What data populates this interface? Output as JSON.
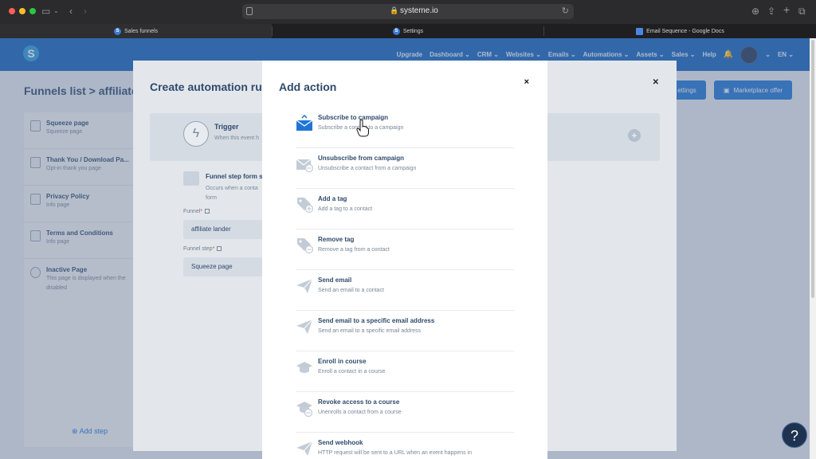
{
  "browser": {
    "url": "systeme.io",
    "tabs": [
      {
        "label": "Sales funnels",
        "icon": "systeme-favicon"
      },
      {
        "label": "Settings",
        "icon": "systeme-favicon"
      },
      {
        "label": "Email Sequence - Google Docs",
        "icon": "google-docs-icon"
      }
    ]
  },
  "navbar": {
    "logo_letter": "S",
    "items": [
      "Upgrade",
      "Dashboard ⌄",
      "CRM ⌄",
      "Websites ⌄",
      "Emails ⌄",
      "Automations ⌄",
      "Assets ⌄",
      "Sales ⌄",
      "Help"
    ],
    "language": "EN ⌄"
  },
  "page": {
    "breadcrumb": "Funnels list  >  affiliate la",
    "settings_button": "ettings",
    "marketplace_button": "Marketplace offer"
  },
  "sidebar": {
    "steps": [
      {
        "title": "Squeeze page",
        "subtitle": "Squeeze page"
      },
      {
        "title": "Thank You / Download Pa...",
        "subtitle": "Opt-in thank you page"
      },
      {
        "title": "Privacy Policy",
        "subtitle": "Info page"
      },
      {
        "title": "Terms and Conditions",
        "subtitle": "Info page"
      },
      {
        "title": "Inactive Page",
        "subtitle": "This page is displayed when the",
        "subtitle2": "disabled"
      }
    ],
    "add_step": "Add step"
  },
  "automation_modal": {
    "title": "Create automation rule",
    "trigger_title": "Trigger",
    "trigger_subtitle": "When this event h",
    "form_step_title": "Funnel step form su",
    "form_step_subtitle": "Occurs when a conta form",
    "funnel_label": "Funnel",
    "funnel_value": "affiliate lander",
    "funnel_step_label": "Funnel step",
    "funnel_step_value": "Squeeze page"
  },
  "add_action_modal": {
    "title": "Add action",
    "close": "×",
    "actions": [
      {
        "title": "Subscribe to campaign",
        "subtitle": "Subscribe a contact to a campaign",
        "icon": "campaign-subscribe-icon"
      },
      {
        "title": "Unsubscribe from campaign",
        "subtitle": "Unsubscribe a contact from a campaign",
        "icon": "campaign-unsubscribe-icon"
      },
      {
        "title": "Add a tag",
        "subtitle": "Add a tag to a contact",
        "icon": "tag-add-icon"
      },
      {
        "title": "Remove tag",
        "subtitle": "Remove a tag from a contact",
        "icon": "tag-remove-icon"
      },
      {
        "title": "Send email",
        "subtitle": "Send an email to a contact",
        "icon": "paper-plane-icon"
      },
      {
        "title": "Send email to a specific email address",
        "subtitle": "Send an email to a specific email address",
        "icon": "paper-plane-icon"
      },
      {
        "title": "Enroll in course",
        "subtitle": "Enroll a contact in a course",
        "icon": "graduation-cap-icon"
      },
      {
        "title": "Revoke access to a course",
        "subtitle": "Unenrolls a contact from a course",
        "icon": "graduation-cap-revoke-icon"
      },
      {
        "title": "Send webhook",
        "subtitle": "HTTP request will be sent to a URL when an event happens in",
        "icon": "paper-plane-icon"
      }
    ]
  },
  "help_button": "?",
  "colors": {
    "navbar": "#1565c0",
    "primary": "#1f75d6",
    "heading": "#2f4a6d",
    "muted": "#7a8796"
  }
}
